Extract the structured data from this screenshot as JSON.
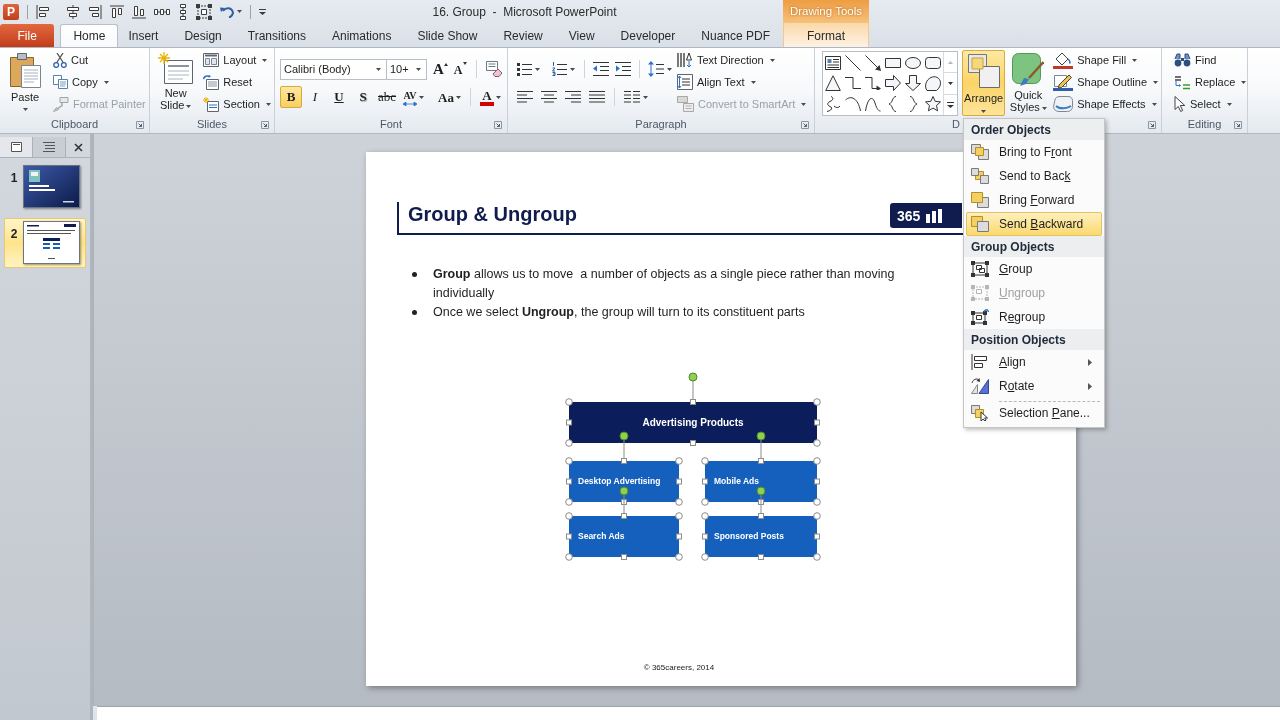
{
  "title_bar": {
    "app_logo": "P",
    "title": "16. Group  -  Microsoft PowerPoint",
    "contextual_group": "Drawing Tools"
  },
  "tabs": [
    {
      "label": "File",
      "kind": "backstage",
      "selected": false
    },
    {
      "label": "Home",
      "kind": "normal",
      "selected": true
    },
    {
      "label": "Insert",
      "kind": "normal",
      "selected": false
    },
    {
      "label": "Design",
      "kind": "normal",
      "selected": false
    },
    {
      "label": "Transitions",
      "kind": "normal",
      "selected": false
    },
    {
      "label": "Animations",
      "kind": "normal",
      "selected": false
    },
    {
      "label": "Slide Show",
      "kind": "normal",
      "selected": false
    },
    {
      "label": "Review",
      "kind": "normal",
      "selected": false
    },
    {
      "label": "View",
      "kind": "normal",
      "selected": false
    },
    {
      "label": "Developer",
      "kind": "normal",
      "selected": false
    },
    {
      "label": "Nuance PDF",
      "kind": "normal",
      "selected": false
    },
    {
      "label": "Format",
      "kind": "contextual",
      "selected": false
    }
  ],
  "ribbon": {
    "clipboard": {
      "label": "Clipboard",
      "paste": {
        "label": "Paste",
        "dropdown": true
      },
      "items": [
        {
          "kind": "cut",
          "label": "Cut",
          "dropdown": false,
          "disabled": false
        },
        {
          "kind": "copy",
          "label": "Copy",
          "dropdown": true,
          "disabled": false
        },
        {
          "kind": "format-painter",
          "label": "Format Painter",
          "dropdown": false,
          "disabled": true
        }
      ]
    },
    "slides": {
      "label": "Slides",
      "new_slide": {
        "label": "New Slide",
        "dropdown": true
      },
      "items": [
        {
          "kind": "layout",
          "label": "Layout",
          "dropdown": true,
          "disabled": false
        },
        {
          "kind": "reset",
          "label": "Reset",
          "dropdown": false,
          "disabled": false
        },
        {
          "kind": "section",
          "label": "Section",
          "dropdown": true,
          "disabled": false
        }
      ]
    },
    "font": {
      "label": "Font",
      "font_name": "Calibri (Body)",
      "font_size": "10+",
      "size_buttons": [
        {
          "kind": "grow",
          "label": "A"
        },
        {
          "kind": "shrink",
          "label": "A"
        }
      ],
      "toggles": [
        {
          "kind": "bold",
          "label": "B",
          "selected": true
        },
        {
          "kind": "italic",
          "label": "I",
          "selected": false
        },
        {
          "kind": "underline",
          "label": "U",
          "selected": false
        },
        {
          "kind": "shadow",
          "label": "S",
          "selected": false
        },
        {
          "kind": "strikethrough",
          "label": "abc",
          "selected": false
        }
      ],
      "menus": [
        {
          "kind": "spacing",
          "label": "AV"
        },
        {
          "kind": "case",
          "label": "Aa"
        },
        {
          "kind": "color",
          "label": "A",
          "color": "#d40000"
        }
      ]
    },
    "paragraph": {
      "label": "Paragraph",
      "items": [
        {
          "kind": "text-direction",
          "label": "Text Direction",
          "dropdown": true,
          "disabled": false
        },
        {
          "kind": "align-text",
          "label": "Align Text",
          "dropdown": true,
          "disabled": false
        },
        {
          "kind": "convert-to-smartart",
          "label": "Convert to SmartArt",
          "dropdown": true,
          "disabled": true
        }
      ]
    },
    "drawing": {
      "label": "D",
      "arrange": {
        "label": "Arrange",
        "expanded": true
      },
      "quick_styles": {
        "label": "Quick Styles",
        "dropdown": true
      },
      "items": [
        {
          "kind": "shape-fill",
          "label": "Shape Fill",
          "dropdown": true,
          "disabled": false
        },
        {
          "kind": "shape-outline",
          "label": "Shape Outline",
          "dropdown": true,
          "disabled": false
        },
        {
          "kind": "shape-effects",
          "label": "Shape Effects",
          "dropdown": true,
          "disabled": false
        }
      ]
    },
    "editing": {
      "label": "Editing",
      "items": [
        {
          "kind": "find",
          "label": "Find",
          "dropdown": false,
          "disabled": false
        },
        {
          "kind": "replace",
          "label": "Replace",
          "dropdown": true,
          "disabled": false
        },
        {
          "kind": "select",
          "label": "Select",
          "dropdown": true,
          "disabled": false
        }
      ]
    }
  },
  "slide_panel": {
    "tabs": [
      {
        "kind": "slides",
        "selected": true
      },
      {
        "kind": "outline",
        "selected": false
      }
    ],
    "slides": [
      {
        "number": "1",
        "kind": "title",
        "selected": false
      },
      {
        "number": "2",
        "kind": "content",
        "selected": true
      }
    ]
  },
  "slide": {
    "title": "Group & Ungroup",
    "logo": "365",
    "bullets": [
      "**Group** allows us to move  a number of objects as a single piece rather than moving\nindividually",
      "Once we select **Ungroup**, the group will turn to its constituent parts"
    ],
    "diagram": {
      "nodes": [
        {
          "kind": "parent",
          "label": "Advertising Products"
        },
        {
          "kind": "child",
          "label": "Desktop Advertising"
        },
        {
          "kind": "child",
          "label": "Mobile Ads"
        },
        {
          "kind": "child",
          "label": "Search Ads"
        },
        {
          "kind": "child",
          "label": "Sponsored Posts"
        }
      ]
    },
    "footer": "© 365careers, 2014"
  },
  "arrange_menu": {
    "sections": [
      {
        "heading": "Order Objects",
        "items": [
          {
            "kind": "bring-to-front",
            "label_start": "Bring to F",
            "access_key": "r",
            "label_end": "ont",
            "selected": false,
            "disabled": false,
            "submenu": false,
            "separated": false
          },
          {
            "kind": "send-to-back",
            "label_start": "Send to Bac",
            "access_key": "k",
            "selected": false,
            "disabled": false,
            "submenu": false,
            "separated": false
          },
          {
            "kind": "bring-forward",
            "label_start": "Bring ",
            "access_key": "F",
            "label_end": "orward",
            "selected": false,
            "disabled": false,
            "submenu": false,
            "separated": false
          },
          {
            "kind": "send-backward",
            "label_start": "Send ",
            "access_key": "B",
            "label_end": "ackward",
            "selected": true,
            "disabled": false,
            "submenu": false,
            "separated": false
          }
        ]
      },
      {
        "heading": "Group Objects",
        "items": [
          {
            "kind": "group",
            "access_key": "G",
            "label_end": "roup",
            "selected": false,
            "disabled": false,
            "submenu": false,
            "separated": false
          },
          {
            "kind": "ungroup",
            "access_key": "U",
            "label_end": "ngroup",
            "selected": false,
            "disabled": true,
            "submenu": false,
            "separated": false
          },
          {
            "kind": "regroup",
            "label_start": "R",
            "access_key": "e",
            "label_end": "group",
            "selected": false,
            "disabled": false,
            "submenu": false,
            "separated": false
          }
        ]
      },
      {
        "heading": "Position Objects",
        "items": [
          {
            "kind": "align",
            "access_key": "A",
            "label_end": "lign",
            "selected": false,
            "disabled": false,
            "submenu": true,
            "separated": false
          },
          {
            "kind": "rotate",
            "label_start": "R",
            "access_key": "o",
            "label_end": "tate",
            "selected": false,
            "disabled": false,
            "submenu": true,
            "separated": false
          },
          {
            "kind": "selection-pane",
            "label_start": "Selection ",
            "access_key": "P",
            "label_end": "ane...",
            "selected": false,
            "disabled": false,
            "submenu": false,
            "separated": true
          }
        ]
      }
    ]
  }
}
